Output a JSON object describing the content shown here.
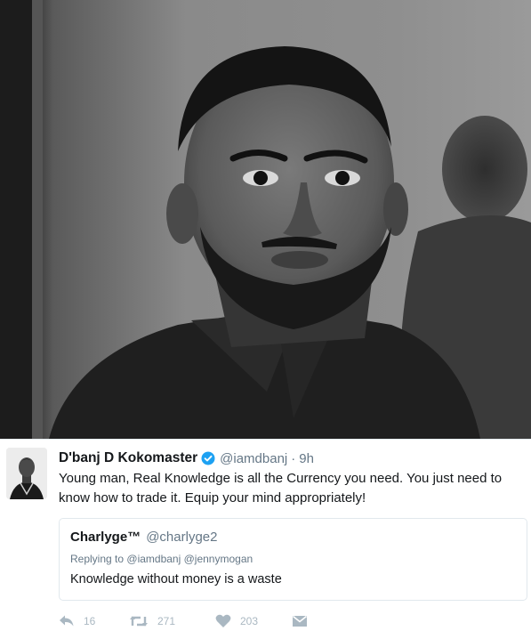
{
  "photo": {
    "alt_subject": "portrait"
  },
  "tweet": {
    "display_name": "D'banj D Kokomaster",
    "handle": "@iamdbanj",
    "separator": "·",
    "time": "9h",
    "text": "Young man, Real Knowledge is all the Currency you need. You just need to know how to trade it. Equip your mind appropriately!"
  },
  "quoted": {
    "display_name": "Charlyge™",
    "handle": "@charlyge2",
    "replying_prefix": "Replying to",
    "replying_mentions": "@iamdbanj @jennymogan",
    "text": "Knowledge without money is a waste"
  },
  "actions": {
    "reply_count": "16",
    "retweet_count": "271",
    "like_count": "203"
  },
  "colors": {
    "verified": "#1da1f2",
    "muted": "#657786",
    "action_gray": "#aab8c2",
    "border": "#e1e8ed"
  },
  "icons": [
    "verified-badge-icon",
    "reply-icon",
    "retweet-icon",
    "heart-icon",
    "direct-message-icon"
  ]
}
